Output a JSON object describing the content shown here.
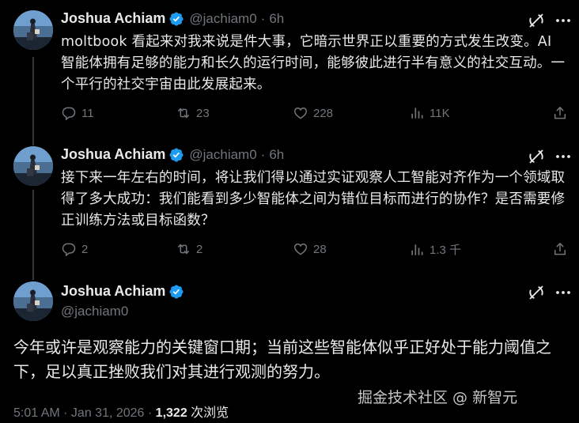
{
  "tweets": [
    {
      "author": {
        "name": "Joshua Achiam",
        "handle": "@jachiam0"
      },
      "time": "6h",
      "text": "moltbook 看起来对我来说是件大事，它暗示世界正以重要的方式发生改变。AI 智能体拥有足够的能力和长久的运行时间，能够彼此进行半有意义的社交互动。一个平行的社交宇宙由此发展起来。",
      "stats": {
        "replies": "11",
        "reposts": "23",
        "likes": "228",
        "views": "11K"
      }
    },
    {
      "author": {
        "name": "Joshua Achiam",
        "handle": "@jachiam0"
      },
      "time": "6h",
      "text": "接下来一年左右的时间，将让我们得以通过实证观察人工智能对齐作为一个领域取得了多大成功：我们能看到多少智能体之间为错位目标而进行的协作？是否需要修正训练方法或目标函数？",
      "stats": {
        "replies": "2",
        "reposts": "2",
        "likes": "28",
        "views": "1.3 千"
      }
    }
  ],
  "main_tweet": {
    "author": {
      "name": "Joshua Achiam",
      "handle": "@jachiam0"
    },
    "text": "今年或许是观察能力的关键窗口期；当前这些智能体似乎正好处于能力阈值之下，足以真正挫败我们对其进行观测的努力。",
    "timestamp": "5:01 AM · Jan 31, 2026 · ",
    "views_count": "1,322",
    "views_label": " 次浏览"
  },
  "watermark": "掘金技术社区 @ 新智元",
  "icons": {
    "verified": "verified-badge-icon",
    "grok": "grok-icon",
    "more": "more-icon",
    "reply": "reply-icon",
    "repost": "repost-icon",
    "like": "like-icon",
    "views": "views-icon",
    "share": "share-icon"
  },
  "colors": {
    "background": "#000000",
    "verified": "#1d9bf0",
    "muted": "#71767b",
    "text": "#e7e9ea"
  }
}
